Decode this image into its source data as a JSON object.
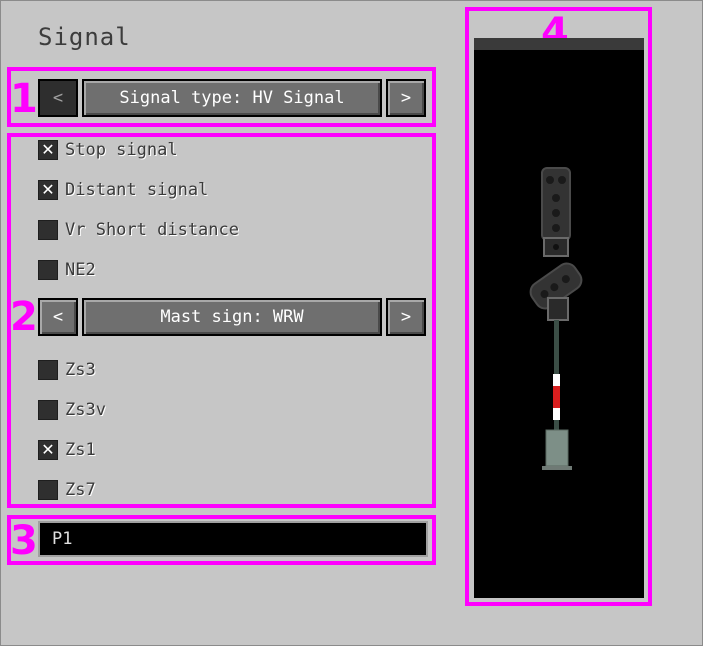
{
  "window": {
    "title": "Signal"
  },
  "annotations": [
    "1",
    "2",
    "3",
    "4"
  ],
  "signal_type": {
    "label": "Signal type: HV Signal",
    "prev": "<",
    "next": ">"
  },
  "options": [
    {
      "label": "Stop signal",
      "checked": true,
      "mark": "✕"
    },
    {
      "label": "Distant signal",
      "checked": true,
      "mark": "✕"
    },
    {
      "label": "Vr Short distance",
      "checked": false,
      "mark": ""
    },
    {
      "label": "NE2",
      "checked": false,
      "mark": ""
    }
  ],
  "mast_sign": {
    "label": "Mast sign: WRW",
    "prev": "<",
    "next": ">"
  },
  "zs_options": [
    {
      "label": "Zs3",
      "checked": false,
      "mark": ""
    },
    {
      "label": "Zs3v",
      "checked": false,
      "mark": ""
    },
    {
      "label": "Zs1",
      "checked": true,
      "mark": "✕"
    },
    {
      "label": "Zs7",
      "checked": false,
      "mark": ""
    }
  ],
  "name_field": {
    "value": "P1"
  },
  "colors": {
    "highlight": "#ff00ff",
    "panel": "#c6c6c6",
    "button": "#6f6f6f"
  }
}
